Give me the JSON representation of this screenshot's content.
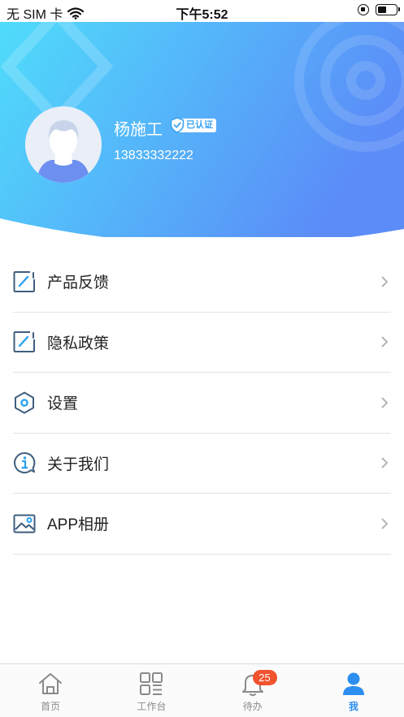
{
  "status_bar": {
    "carrier": "无 SIM 卡",
    "time": "下午5:52"
  },
  "profile": {
    "name": "杨施工",
    "verified_label": "已认证",
    "phone": "13833332222"
  },
  "menu": {
    "items": [
      {
        "label": "产品反馈",
        "icon": "edit-note-icon"
      },
      {
        "label": "隐私政策",
        "icon": "edit-note-icon"
      },
      {
        "label": "设置",
        "icon": "hexagon-settings-icon"
      },
      {
        "label": "关于我们",
        "icon": "info-bubble-icon"
      },
      {
        "label": "APP相册",
        "icon": "image-album-icon"
      }
    ]
  },
  "tabbar": {
    "tabs": [
      {
        "label": "首页",
        "icon": "home-icon"
      },
      {
        "label": "工作台",
        "icon": "grid-icon"
      },
      {
        "label": "待办",
        "icon": "bell-icon",
        "badge": "25"
      },
      {
        "label": "我",
        "icon": "person-icon",
        "active": true
      }
    ]
  },
  "colors": {
    "header_gradient_start": "#4fdcfb",
    "header_gradient_end": "#5b8cf8",
    "active_tab": "#2b8ef0",
    "badge": "#f2532f",
    "icon_stroke": "#3f5e7e",
    "icon_accent": "#2ba0f0"
  }
}
